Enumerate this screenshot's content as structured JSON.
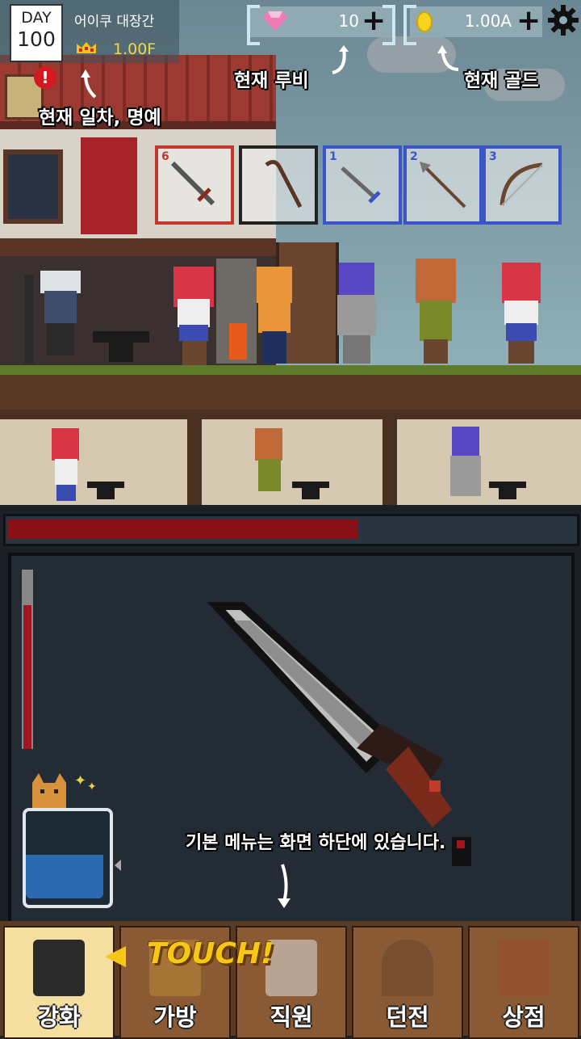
{
  "hud": {
    "day_label": "DAY",
    "day_number": "100",
    "shop_name": "어이쿠 대장간",
    "fame": "1.00F",
    "ruby": "10",
    "gold": "1.00A",
    "plus": "+"
  },
  "tips": {
    "ruby": "현재 루비",
    "gold": "현재 골드",
    "day_fame": "현재 일차, 명예",
    "menu": "기본 메뉴는 화면 하단에 있습니다.",
    "touch": "TOUCH!",
    "touch_arrow": "◀"
  },
  "weapon_slots": [
    {
      "num": "6",
      "icon": "sword-icon",
      "color": "#c0392b"
    },
    {
      "num": "",
      "icon": "staff-icon",
      "color": "#222222"
    },
    {
      "num": "1",
      "icon": "dagger-icon",
      "color": "#3a55c6"
    },
    {
      "num": "2",
      "icon": "spear-icon",
      "color": "#3a55c6"
    },
    {
      "num": "3",
      "icon": "bow-icon",
      "color": "#3a55c6"
    }
  ],
  "forge": {
    "progress_percent": 62,
    "heat_percent": 80
  },
  "nav": {
    "tabs": [
      {
        "label": "강화",
        "icon": "anvil-hammer-icon",
        "active": true
      },
      {
        "label": "가방",
        "icon": "bag-icon",
        "active": false
      },
      {
        "label": "직원",
        "icon": "staff-member-icon",
        "active": false
      },
      {
        "label": "던전",
        "icon": "dungeon-door-icon",
        "active": false
      },
      {
        "label": "상점",
        "icon": "treasure-chest-icon",
        "active": false
      }
    ]
  },
  "colors": {
    "accent": "#f7c718",
    "fame": "#f4d64c",
    "progress": "#8a1018"
  }
}
